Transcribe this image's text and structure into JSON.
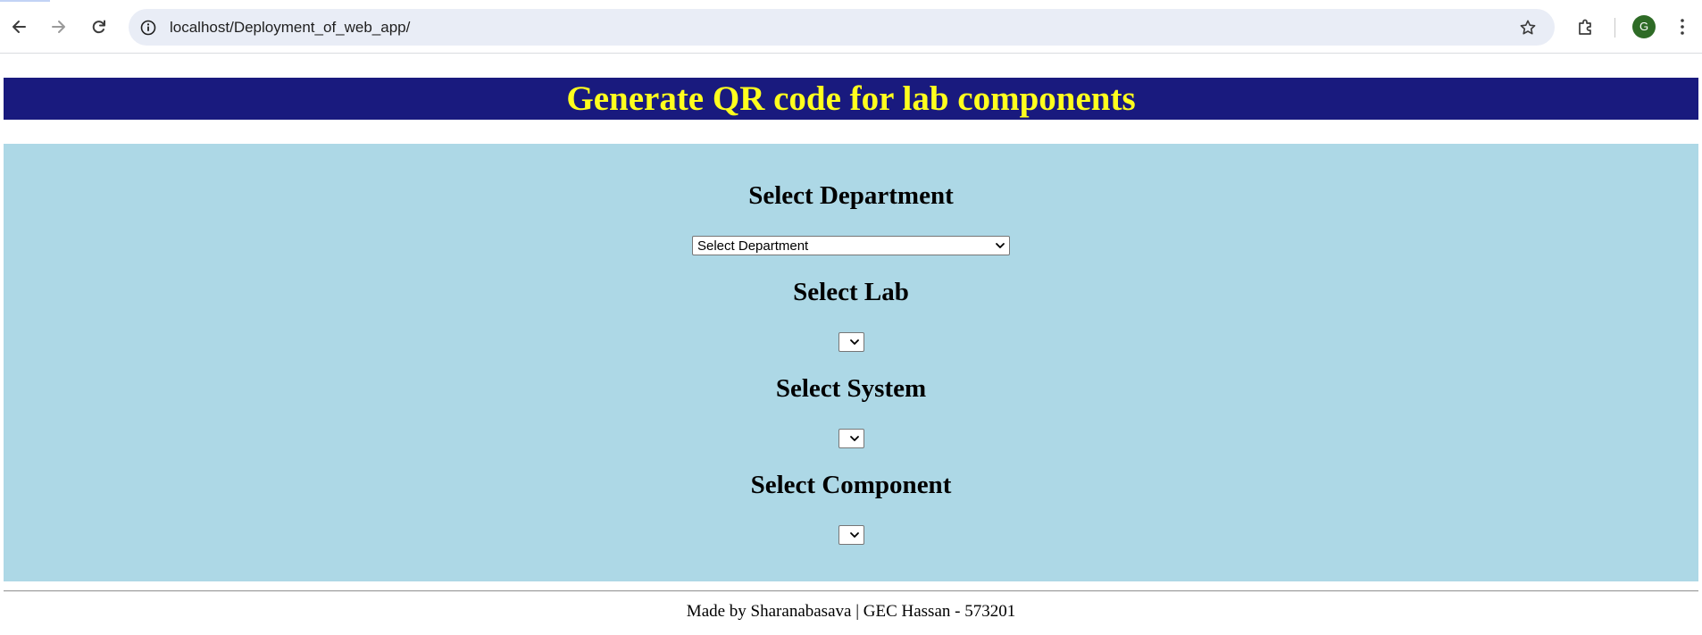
{
  "browser": {
    "url": "localhost/Deployment_of_web_app/",
    "profile_initial": "G",
    "icons": {
      "back": "arrow-left-icon",
      "forward": "arrow-right-icon",
      "reload": "reload-icon",
      "site_info": "info-icon",
      "bookmark": "star-icon",
      "extensions": "puzzle-icon",
      "menu": "kebab-menu-icon"
    }
  },
  "header": {
    "title": "Generate QR code for lab components",
    "background_color": "#191a7e",
    "text_color": "#ffff1e"
  },
  "form": {
    "background_color": "#add8e6",
    "department": {
      "heading": "Select Department",
      "selected": "Select Department"
    },
    "lab": {
      "heading": "Select Lab",
      "selected": ""
    },
    "system": {
      "heading": "Select System",
      "selected": ""
    },
    "component": {
      "heading": "Select Component",
      "selected": ""
    }
  },
  "footer": {
    "text": "Made by Sharanabasava | GEC Hassan - 573201"
  }
}
